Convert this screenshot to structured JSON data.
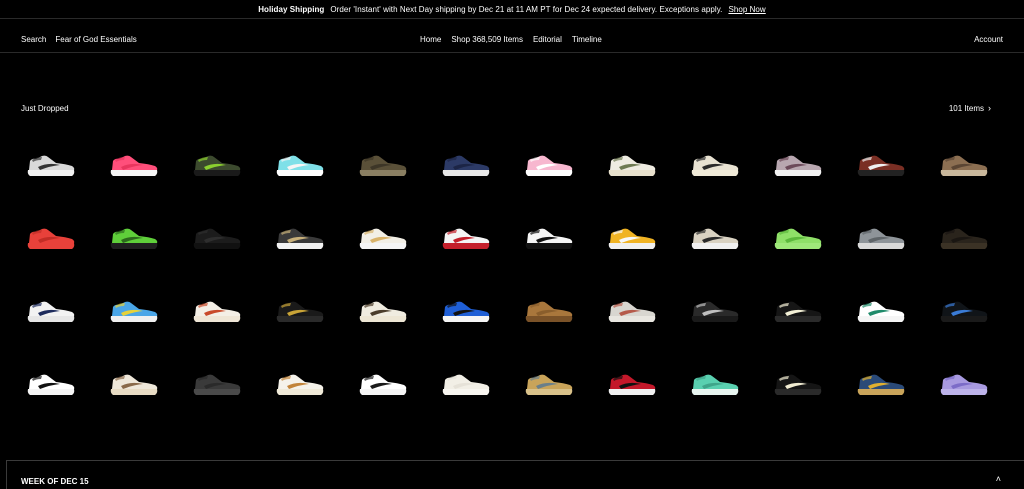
{
  "banner": {
    "title": "Holiday Shipping",
    "message": "Order 'Instant' with Next Day shipping by Dec 21 at 11 AM PT for Dec 24 expected delivery. Exceptions apply.",
    "link": "Shop Now"
  },
  "nav": {
    "search_label": "Search",
    "search_value": "Fear of God Essentials",
    "links": [
      "Home",
      "Shop 368,509 Items",
      "Editorial",
      "Timeline"
    ],
    "account": "Account"
  },
  "section": {
    "title": "Just Dropped",
    "count": "101 Items",
    "count_icon": "chevron-right-icon"
  },
  "products": [
    {
      "upper": "#d9d9d9",
      "accent": "#333333",
      "sole": "#f2f2f2"
    },
    {
      "upper": "#ff4f7b",
      "accent": "#e8365f",
      "sole": "#f5f5f5"
    },
    {
      "upper": "#3c4a2e",
      "accent": "#8bd02f",
      "sole": "#1a1a1a"
    },
    {
      "upper": "#7fe0e8",
      "accent": "#f5f5f5",
      "sole": "#ffffff"
    },
    {
      "upper": "#5a5038",
      "accent": "#3d3627",
      "sole": "#8a7f62"
    },
    {
      "upper": "#2c3a66",
      "accent": "#1c2546",
      "sole": "#e8e8e8"
    },
    {
      "upper": "#f7b7cf",
      "accent": "#ffffff",
      "sole": "#ffffff"
    },
    {
      "upper": "#efece2",
      "accent": "#6f7b54",
      "sole": "#e7e0cc"
    },
    {
      "upper": "#e8e2d2",
      "accent": "#2a2a2a",
      "sole": "#f0ead8"
    },
    {
      "upper": "#b8a7b0",
      "accent": "#6c4a5a",
      "sole": "#f2f2f2"
    },
    {
      "upper": "#7a2f24",
      "accent": "#f0f0f0",
      "sole": "#222222"
    },
    {
      "upper": "#8c6f52",
      "accent": "#5b4634",
      "sole": "#c9b89c"
    },
    {
      "upper": "#e8413a",
      "accent": "#c22d26",
      "sole": "#e8413a"
    },
    {
      "upper": "#5fcf3a",
      "accent": "#2c6a1c",
      "sole": "#1f1f1f"
    },
    {
      "upper": "#1c1c1c",
      "accent": "#2e2e2e",
      "sole": "#111111"
    },
    {
      "upper": "#3a3a3a",
      "accent": "#c8b07a",
      "sole": "#f2f2f2"
    },
    {
      "upper": "#f2efe6",
      "accent": "#d9b36a",
      "sole": "#f5f5f5"
    },
    {
      "upper": "#f4f4f4",
      "accent": "#c41f2b",
      "sole": "#c41f2b"
    },
    {
      "upper": "#f5f5f5",
      "accent": "#111111",
      "sole": "#111111"
    },
    {
      "upper": "#f0b323",
      "accent": "#f8f8f8",
      "sole": "#f0f0f0"
    },
    {
      "upper": "#d9d2c2",
      "accent": "#2a2a2a",
      "sole": "#f0f0f0"
    },
    {
      "upper": "#8fe068",
      "accent": "#5cb93c",
      "sole": "#9fe87a"
    },
    {
      "upper": "#8e9499",
      "accent": "#5f6569",
      "sole": "#d9d9d9"
    },
    {
      "upper": "#2a241c",
      "accent": "#1a1612",
      "sole": "#3b3225"
    },
    {
      "upper": "#f2f2f2",
      "accent": "#1d2b5c",
      "sole": "#e6e6e6"
    },
    {
      "upper": "#4aa6e8",
      "accent": "#e6d23a",
      "sole": "#f0f0f0"
    },
    {
      "upper": "#f4efe6",
      "accent": "#c94a2a",
      "sole": "#efe6d6"
    },
    {
      "upper": "#1a1a1a",
      "accent": "#c9a437",
      "sole": "#2a2a2a"
    },
    {
      "upper": "#f0ece0",
      "accent": "#4a3c2a",
      "sole": "#ede6d4"
    },
    {
      "upper": "#1f5fd6",
      "accent": "#111111",
      "sole": "#f5f5f5"
    },
    {
      "upper": "#a9773c",
      "accent": "#8a5e2c",
      "sole": "#7a5228"
    },
    {
      "upper": "#d8d6d0",
      "accent": "#b55a4a",
      "sole": "#e8e6e0"
    },
    {
      "upper": "#2a2a2a",
      "accent": "#bfbfbf",
      "sole": "#1a1a1a"
    },
    {
      "upper": "#161616",
      "accent": "#f3f0d6",
      "sole": "#2a2a2a"
    },
    {
      "upper": "#ffffff",
      "accent": "#1f8a6a",
      "sole": "#f5f5f5"
    },
    {
      "upper": "#101418",
      "accent": "#3a7bd5",
      "sole": "#1a1a1a"
    },
    {
      "upper": "#ffffff",
      "accent": "#111111",
      "sole": "#f5f5f5"
    },
    {
      "upper": "#efe8da",
      "accent": "#8a6a4a",
      "sole": "#e8dcc4"
    },
    {
      "upper": "#3a3a3a",
      "accent": "#2a2a2a",
      "sole": "#4a4a4a"
    },
    {
      "upper": "#f5f2ea",
      "accent": "#c2843a",
      "sole": "#f0ead8"
    },
    {
      "upper": "#ffffff",
      "accent": "#1a1a1a",
      "sole": "#f5f5f5"
    },
    {
      "upper": "#f2efe6",
      "accent": "#e6e2d8",
      "sole": "#f8f6f0"
    },
    {
      "upper": "#c9a45a",
      "accent": "#6a7f8a",
      "sole": "#d9c28a"
    },
    {
      "upper": "#c4182a",
      "accent": "#111111",
      "sole": "#f0f0f0"
    },
    {
      "upper": "#5ad0b0",
      "accent": "#3fa58a",
      "sole": "#e8f5f0"
    },
    {
      "upper": "#151515",
      "accent": "#f1ecd2",
      "sole": "#2a2a2a"
    },
    {
      "upper": "#2a4a78",
      "accent": "#e0b030",
      "sole": "#c9a45a"
    },
    {
      "upper": "#a89ae0",
      "accent": "#7c6cc8",
      "sole": "#bdb3ea"
    }
  ],
  "week": {
    "label": "WEEK OF DEC 15",
    "toggle_icon": "chevron-up-icon"
  }
}
